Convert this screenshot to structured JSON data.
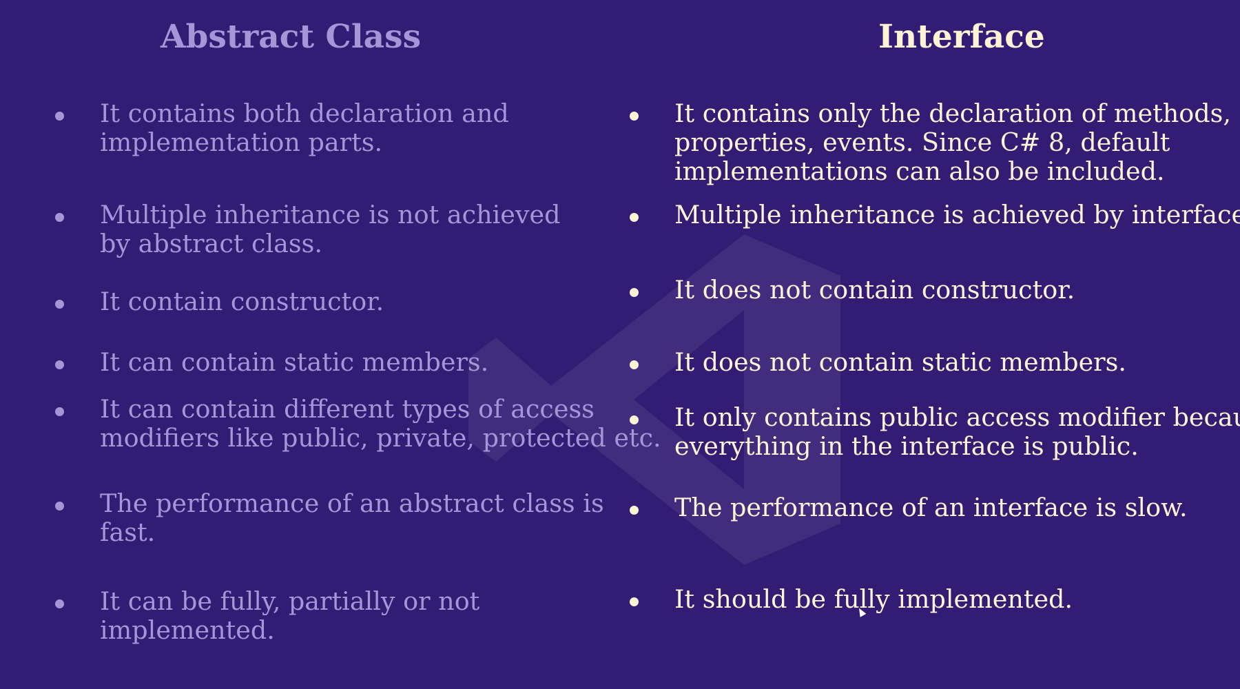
{
  "slide": {
    "left_heading": "Abstract Class",
    "right_heading": "Interface",
    "left_items": [
      [
        "It contains both declaration and",
        "implementation parts."
      ],
      [
        "Multiple inheritance is not achieved",
        "by abstract class."
      ],
      [
        "It contain constructor."
      ],
      [
        "It can contain static members."
      ],
      [
        "It can contain different types of access",
        "modifiers like public, private, protected etc."
      ],
      [
        "The performance of an abstract class is",
        "fast."
      ],
      [
        "It can be fully, partially or not",
        "implemented."
      ]
    ],
    "right_items": [
      [
        "It contains only the declaration of methods,",
        "properties, events. Since C# 8, default",
        "implementations can also be included."
      ],
      [
        "Multiple inheritance is achieved by interface."
      ],
      [
        "It does not contain constructor."
      ],
      [
        "It does not contain static members."
      ],
      [
        "It only contains public access modifier because",
        "everything in the interface is public."
      ],
      [
        "The performance of an interface is slow."
      ],
      [
        "It should be fully implemented."
      ]
    ],
    "watermark_icon": "visual-studio-logo-icon",
    "colors": {
      "background": "#321c74",
      "left_text": "#a795d8",
      "right_text": "#fff3d6"
    }
  }
}
